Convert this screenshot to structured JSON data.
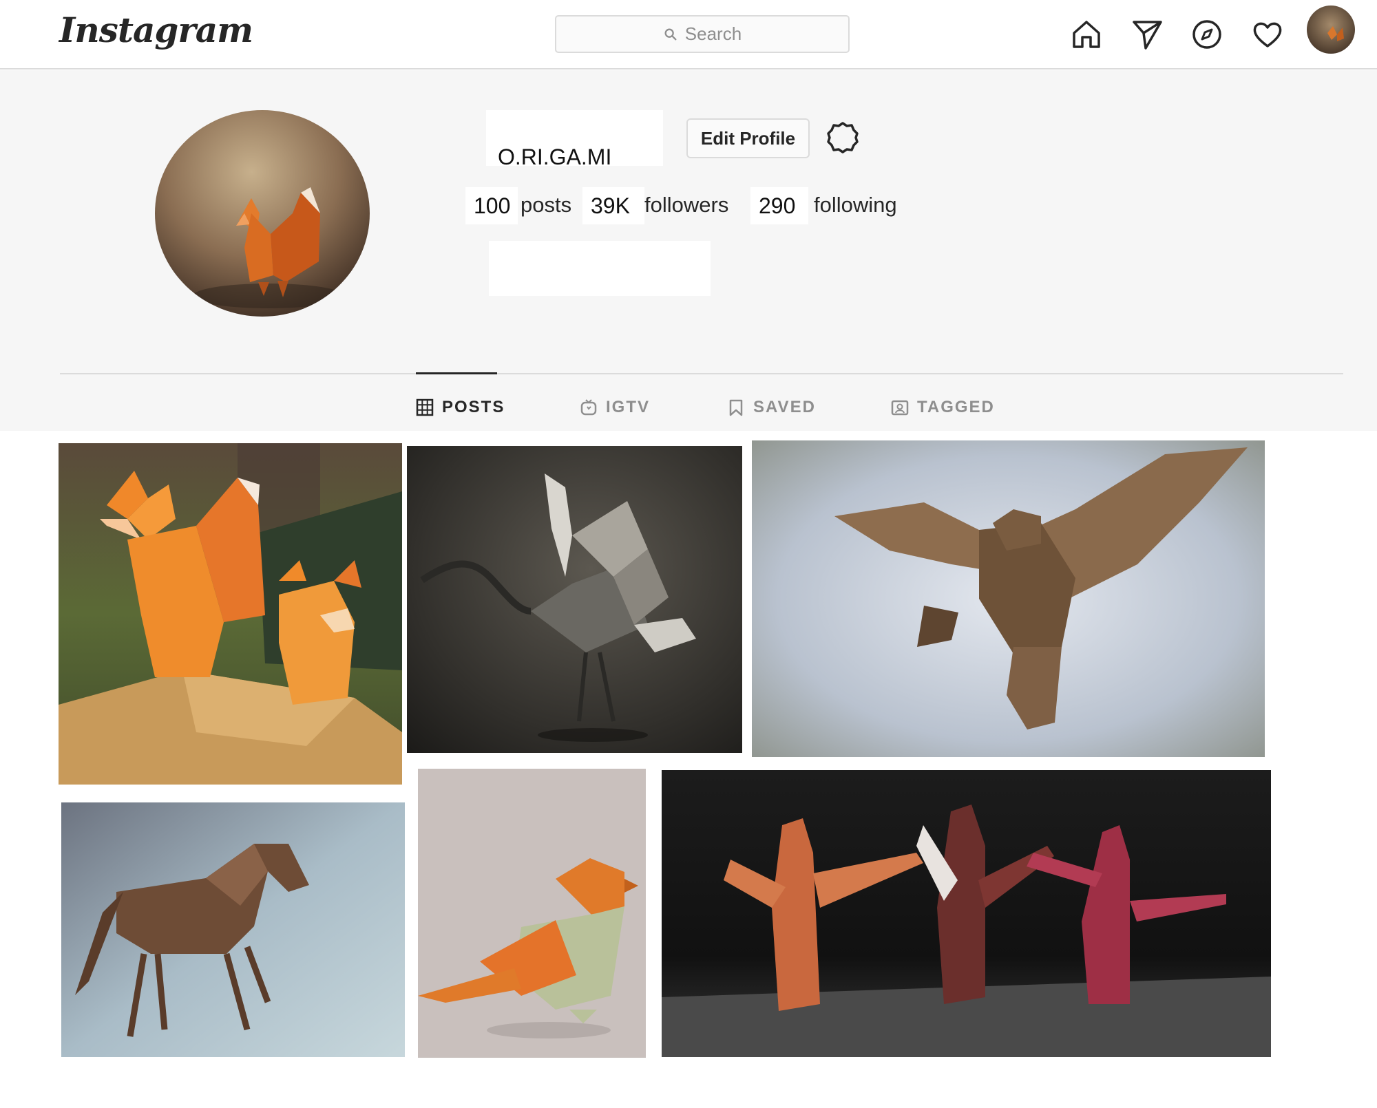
{
  "nav": {
    "logo": "Instagram",
    "search_placeholder": "Search",
    "icons": [
      "home-icon",
      "direct-message-icon",
      "explore-compass-icon",
      "activity-heart-icon",
      "profile-avatar"
    ]
  },
  "profile": {
    "username": "O.RI.GA.MI",
    "edit_label": "Edit Profile",
    "stats": {
      "posts_count": "100",
      "posts_label": "posts",
      "followers_count": "39K",
      "followers_label": "followers",
      "following_count": "290",
      "following_label": "following"
    }
  },
  "tabs": [
    {
      "label": "POSTS",
      "icon": "grid-icon",
      "active": true
    },
    {
      "label": "IGTV",
      "icon": "igtv-icon",
      "active": false
    },
    {
      "label": "SAVED",
      "icon": "bookmark-icon",
      "active": false
    },
    {
      "label": "TAGGED",
      "icon": "tagged-icon",
      "active": false
    }
  ],
  "posts": [
    {
      "subject": "origami foxes"
    },
    {
      "subject": "origami crane"
    },
    {
      "subject": "origami owl"
    },
    {
      "subject": "origami horse"
    },
    {
      "subject": "origami bird"
    },
    {
      "subject": "origami dancers"
    }
  ],
  "colors": {
    "border": "#dbdbdb",
    "profile_bg": "#f6f6f6",
    "text": "#262626",
    "muted": "#8e8e8e"
  }
}
